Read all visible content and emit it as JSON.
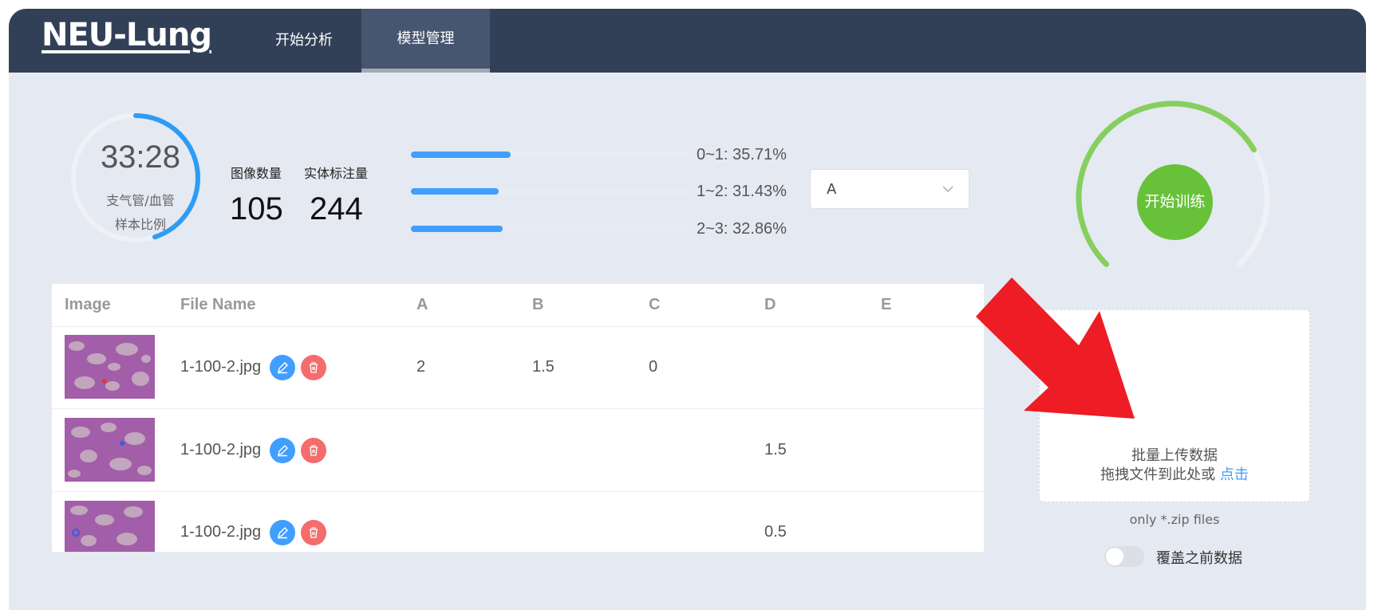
{
  "header": {
    "logo": "NEU-Lung",
    "nav": [
      {
        "label": "开始分析",
        "active": false
      },
      {
        "label": "模型管理",
        "active": true
      }
    ]
  },
  "summary": {
    "timer": "33:28",
    "ring_label_line1": "支气管/血管",
    "ring_label_line2": "样本比例",
    "ring_progress": 0.45,
    "stats": [
      {
        "label": "图像数量",
        "value": "105"
      },
      {
        "label": "实体标注量",
        "value": "244"
      }
    ],
    "distribution": [
      {
        "label": "0~1: 35.71%",
        "value": 35.71
      },
      {
        "label": "1~2: 31.43%",
        "value": 31.43
      },
      {
        "label": "2~3: 32.86%",
        "value": 32.86
      }
    ],
    "select": {
      "value": "A"
    }
  },
  "table": {
    "columns": [
      "Image",
      "File Name",
      "A",
      "B",
      "C",
      "D",
      "E"
    ],
    "rows": [
      {
        "file": "1-100-2.jpg",
        "A": "2",
        "B": "1.5",
        "C": "0",
        "D": "",
        "E": ""
      },
      {
        "file": "1-100-2.jpg",
        "A": "",
        "B": "",
        "C": "",
        "D": "1.5",
        "E": ""
      },
      {
        "file": "1-100-2.jpg",
        "A": "",
        "B": "",
        "C": "",
        "D": "0.5",
        "E": ""
      }
    ]
  },
  "train": {
    "label": "开始训练",
    "ring_progress": 0.72
  },
  "upload": {
    "title": "批量上传数据",
    "hint": "拖拽文件到此处或",
    "link": "点击",
    "note": "only *.zip files"
  },
  "overwrite": {
    "label": "覆盖之前数据",
    "enabled": false
  },
  "colors": {
    "header": "#324057",
    "primary": "#409eff",
    "danger": "#f56c6c",
    "success": "#67c23a",
    "annotation_arrow": "#ee1c25"
  },
  "icons": [
    "edit-icon",
    "trash-icon",
    "chevron-down-icon",
    "annotation-arrow"
  ]
}
